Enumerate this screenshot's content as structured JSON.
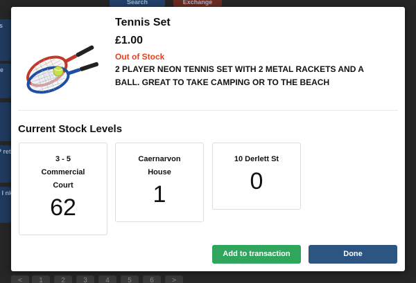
{
  "background": {
    "top_buttons": [
      "Search",
      "Exchange"
    ],
    "side_labels": [
      "ams",
      "rtise",
      "sh",
      "s, P\nretai",
      "s & I\nnks"
    ],
    "pagination": [
      "<",
      "1",
      "2",
      "3",
      "4",
      "5",
      "6",
      ">"
    ]
  },
  "product": {
    "image_icon": "tennis-rackets-image",
    "title": "Tennis Set",
    "price": "£1.00",
    "stock_status": "Out of Stock",
    "description": "2 PLAYER NEON TENNIS SET WITH 2 METAL RACKETS AND A BALL. GREAT TO TAKE CAMPING OR TO THE BEACH"
  },
  "stock": {
    "heading": "Current Stock Levels",
    "locations": [
      {
        "name": "3 - 5 Commercial Court",
        "count": "62"
      },
      {
        "name": "Caernarvon House",
        "count": "1"
      },
      {
        "name": "10 Derlett St",
        "count": "0"
      }
    ]
  },
  "buttons": {
    "add": "Add to transaction",
    "done": "Done"
  },
  "colors": {
    "out_of_stock": "#e8401c",
    "add_button": "#2fa65c",
    "done_button": "#2d5584"
  }
}
